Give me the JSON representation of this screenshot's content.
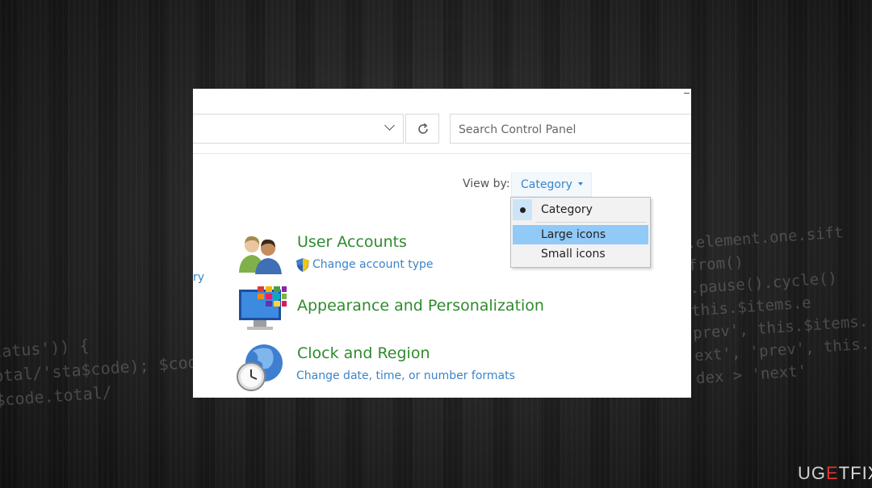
{
  "toolbar": {
    "search_placeholder": "Search Control Panel"
  },
  "view_by": {
    "label": "View by:",
    "selected": "Category"
  },
  "dropdown": {
    "options": [
      "Category",
      "Large icons",
      "Small icons"
    ],
    "checked": "Category",
    "highlighted": "Large icons"
  },
  "left_pane": {
    "partial_link": "ry"
  },
  "categories": [
    {
      "title": "User Accounts",
      "link": "Change account type",
      "icon": "users-icon"
    },
    {
      "title": "Appearance and Personalization",
      "link": "",
      "icon": "display-icon"
    },
    {
      "title": "Clock and Region",
      "link": "Change date, time, or number formats",
      "icon": "clock-globe-icon"
    }
  ],
  "background_code": {
    "left": "tatus')) {\notal/'sta$code); $code\n$code.total/",
    "right": ".element.one.sift\nfrom()\n.pause().cycle()\nthis.$items.e\nprev', this.$items.\next', 'prev', this.\ndex > 'next'"
  },
  "watermark": {
    "prefix": "UG",
    "e": "E",
    "suffix": "TFIX"
  },
  "colors": {
    "category_title": "#2e8b2e",
    "link": "#3a84c9",
    "highlight": "#91c9f7"
  }
}
